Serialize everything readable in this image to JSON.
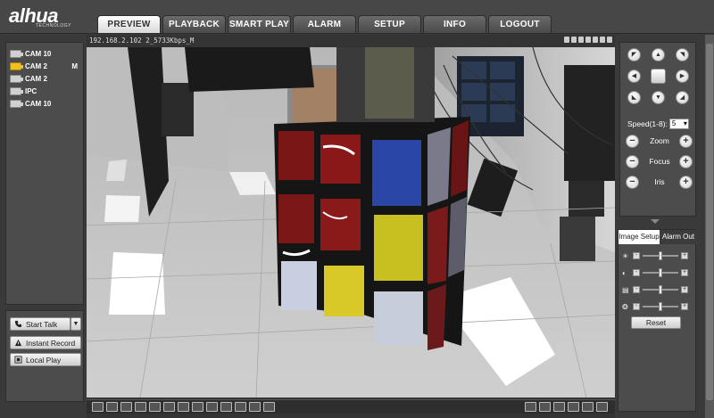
{
  "brand": {
    "logo_text": "alhua",
    "logo_sub": "TECHNOLOGY"
  },
  "tabs": [
    {
      "label": "PREVIEW",
      "active": true
    },
    {
      "label": "PLAYBACK"
    },
    {
      "label": "SMART PLAY"
    },
    {
      "label": "ALARM"
    },
    {
      "label": "SETUP"
    },
    {
      "label": "INFO"
    },
    {
      "label": "LOGOUT"
    }
  ],
  "cameras": [
    {
      "label": "CAM 10",
      "active": false,
      "mark": ""
    },
    {
      "label": "CAM 2",
      "active": true,
      "mark": "M"
    },
    {
      "label": "CAM 2",
      "active": false,
      "mark": ""
    },
    {
      "label": "IPC",
      "active": false,
      "mark": ""
    },
    {
      "label": "CAM 10",
      "active": false,
      "mark": ""
    }
  ],
  "controls": {
    "start_talk": "Start Talk",
    "instant_record": "Instant Record",
    "local_play": "Local Play"
  },
  "video": {
    "overlay_text": "192.168.2.102 2_5733Kbps_M"
  },
  "ptz": {
    "speed_label": "Speed(1-8):",
    "speed_value": "5",
    "zoom": "Zoom",
    "focus": "Focus",
    "iris": "Iris"
  },
  "image_setup": {
    "tab_image": "Image Setup",
    "tab_alarm": "Alarm Out",
    "reset": "Reset",
    "sliders": [
      {
        "icon": "brightness-icon",
        "level": 0.5
      },
      {
        "icon": "contrast-icon",
        "level": 0.5
      },
      {
        "icon": "saturation-icon",
        "level": 0.5
      },
      {
        "icon": "hue-icon",
        "level": 0.5
      }
    ]
  },
  "colors": {
    "active_tab": "#ffffff",
    "active_cam": "#f0c020",
    "panel": "#4c4c4c"
  }
}
